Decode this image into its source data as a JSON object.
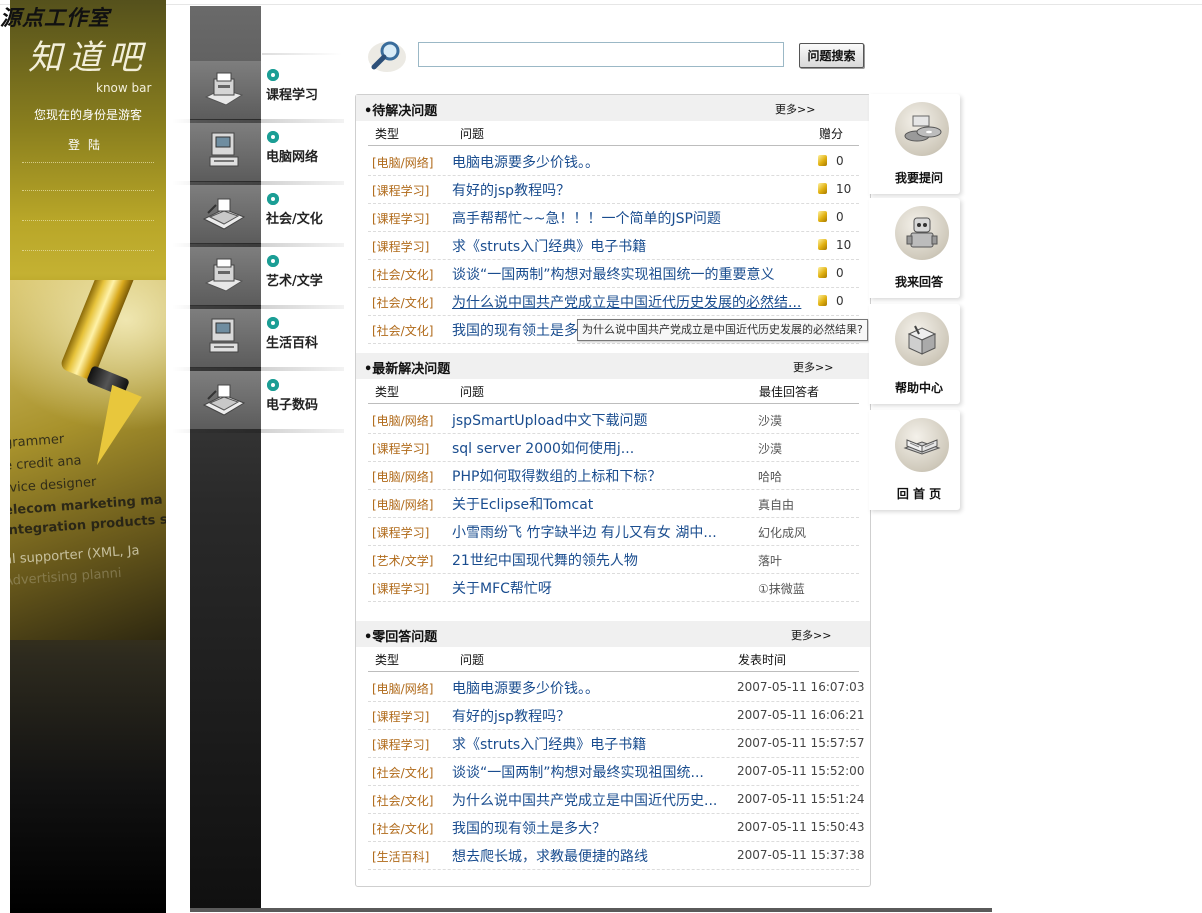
{
  "banner": {
    "studio": "源点工作室",
    "logo": "知道吧",
    "logo_sub": "know bar",
    "identity": "您现在的身份是游客",
    "login": "登陆",
    "paper_lines": [
      "grammer",
      "e credit ana",
      "rvice designer",
      "elecom marketing ma",
      "integration products s",
      "al supporter (XML, Ja",
      "Advertising planni"
    ]
  },
  "categories": [
    {
      "label": "课程学习",
      "icon": "printer-icon"
    },
    {
      "label": "电脑网络",
      "icon": "computer-icon"
    },
    {
      "label": "社会/文化",
      "icon": "fax-icon"
    },
    {
      "label": "艺术/文学",
      "icon": "printer-icon"
    },
    {
      "label": "生活百科",
      "icon": "computer-icon"
    },
    {
      "label": "电子数码",
      "icon": "fax-icon"
    }
  ],
  "search": {
    "icon": "magnifier-icon",
    "value": "",
    "button": "问题搜索"
  },
  "pending": {
    "title": "•待解决问题",
    "more": "更多>>",
    "headers": {
      "type": "类型",
      "question": "问题",
      "reward": "赠分"
    },
    "rows": [
      {
        "type": "[电脑/网络]",
        "question": "电脑电源要多少价钱。。",
        "reward": "0"
      },
      {
        "type": "[课程学习]",
        "question": "有好的jsp教程吗？",
        "reward": "10"
      },
      {
        "type": "[课程学习]",
        "question": "高手帮帮忙~~急！！！一个简单的JSP问题",
        "reward": "0"
      },
      {
        "type": "[课程学习]",
        "question": "求《struts入门经典》电子书籍",
        "reward": "10"
      },
      {
        "type": "[社会/文化]",
        "question": "谈谈“一国两制”构想对最终实现祖国统一的重要意义",
        "reward": "0"
      },
      {
        "type": "[社会/文化]",
        "question": "为什么说中国共产党成立是中国近代历史发展的必然结...",
        "reward": "0"
      },
      {
        "type": "[社会/文化]",
        "question": "我国的现有领土是多",
        "reward": ""
      }
    ],
    "tooltip": "为什么说中国共产党成立是中国近代历史发展的必然结果?"
  },
  "solved": {
    "title": "•最新解决问题",
    "more": "更多>>",
    "headers": {
      "type": "类型",
      "question": "问题",
      "answerer": "最佳回答者"
    },
    "rows": [
      {
        "type": "[电脑/网络]",
        "question": "jspSmartUpload中文下载问题",
        "answerer": "沙漠"
      },
      {
        "type": "[课程学习]",
        "question": "sql server 2000如何使用j...",
        "answerer": "沙漠"
      },
      {
        "type": "[电脑/网络]",
        "question": "PHP如何取得数组的上标和下标？",
        "answerer": "哈哈"
      },
      {
        "type": "[电脑/网络]",
        "question": "关于Eclipse和Tomcat",
        "answerer": "真自由"
      },
      {
        "type": "[课程学习]",
        "question": "小雪雨纷飞 竹字缺半边 有儿又有女 湖中...",
        "answerer": "幻化成风"
      },
      {
        "type": "[艺术/文学]",
        "question": "21世纪中国现代舞的领先人物",
        "answerer": "落叶"
      },
      {
        "type": "[课程学习]",
        "question": "关于MFC帮忙呀",
        "answerer": "①抹微蓝"
      }
    ]
  },
  "zero": {
    "title": "•零回答问题",
    "more": "更多>>",
    "headers": {
      "type": "类型",
      "question": "问题",
      "time": "发表时间"
    },
    "rows": [
      {
        "type": "[电脑/网络]",
        "question": "电脑电源要多少价钱。。",
        "time": "2007-05-11 16:07:03"
      },
      {
        "type": "[课程学习]",
        "question": "有好的jsp教程吗？",
        "time": "2007-05-11 16:06:21"
      },
      {
        "type": "[课程学习]",
        "question": "求《struts入门经典》电子书籍",
        "time": "2007-05-11 15:57:57"
      },
      {
        "type": "[社会/文化]",
        "question": "谈谈“一国两制”构想对最终实现祖国统...",
        "time": "2007-05-11 15:52:00"
      },
      {
        "type": "[社会/文化]",
        "question": "为什么说中国共产党成立是中国近代历史...",
        "time": "2007-05-11 15:51:24"
      },
      {
        "type": "[社会/文化]",
        "question": "我国的现有领土是多大？",
        "time": "2007-05-11 15:50:43"
      },
      {
        "type": "[生活百科]",
        "question": "想去爬长城，求教最便捷的路线",
        "time": "2007-05-11 15:37:38"
      }
    ]
  },
  "quick_links": [
    {
      "label": "我要提问",
      "icon": "cd-icon"
    },
    {
      "label": "我来回答",
      "icon": "robot-icon"
    },
    {
      "label": "帮助中心",
      "icon": "box-icon"
    },
    {
      "label": "回 首 页",
      "icon": "book-icon"
    }
  ],
  "colors": {
    "category_type": "#b06a1a",
    "question_link": "#1a4d8f",
    "category_dot": "#1b9e95"
  }
}
